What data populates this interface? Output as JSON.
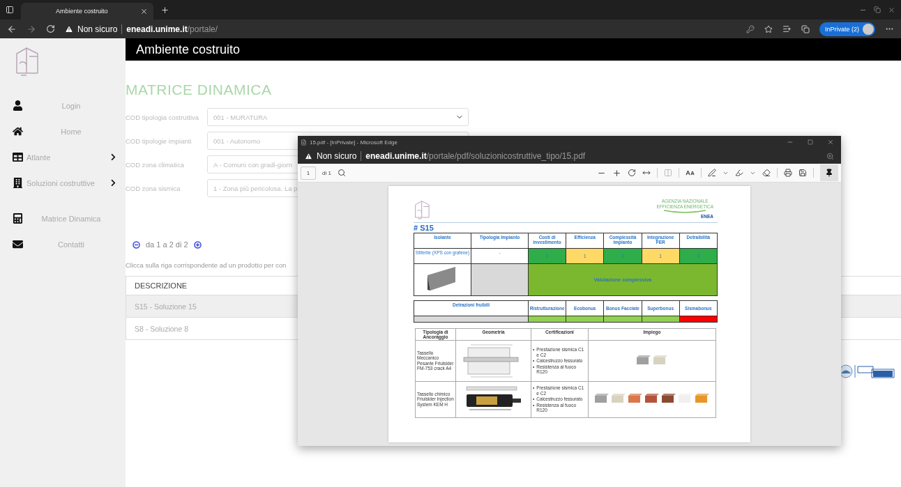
{
  "browser": {
    "tab_title": "Ambiente costruito",
    "security": "Non sicuro",
    "url_host": "eneadi.unime.it",
    "url_path": "/portale/",
    "profile": "InPrivate (2)"
  },
  "sidebar": {
    "items": [
      {
        "kind": "user",
        "label": "Login",
        "submenu": false
      },
      {
        "kind": "home",
        "label": "Home",
        "submenu": false
      },
      {
        "kind": "table",
        "label": "Atlante",
        "submenu": true
      },
      {
        "kind": "building",
        "label": "Soluzioni costruttive",
        "submenu": true
      },
      {
        "kind": "calculator",
        "label": "Matrice Dinamica",
        "submenu": false
      },
      {
        "kind": "mail",
        "label": "Contatti",
        "submenu": false
      }
    ]
  },
  "header": {
    "title": "Ambiente costruito"
  },
  "page_title": "MATRICE DINAMICA",
  "filters": [
    {
      "label": "COD tipologia costruttiva",
      "value": "001 - MURATURA"
    },
    {
      "label": "COD tipologie impianti",
      "value": "001 - Autonomo"
    },
    {
      "label": "COD zona climatica",
      "value": "A - Comuni con gradi-giorn"
    },
    {
      "label": "COD zona sismica",
      "value": "1 - Zona più pericolosa. La p"
    }
  ],
  "pager": {
    "text": "da 1 a 2 di 2"
  },
  "hint": "Clicca sulla riga corrispondente ad un prodotto per con",
  "table": {
    "columns": [
      "DESCRIZIONE"
    ],
    "rows": [
      {
        "cells": [
          "S15 - Soluzione 15"
        ],
        "selected": true
      },
      {
        "cells": [
          "S8 - Soluzione 8"
        ],
        "selected": false
      }
    ]
  },
  "pdf_window": {
    "title": "15.pdf - [InPrivate] - Microsoft Edge",
    "security": "Non sicuro",
    "url_host": "eneadi.unime.it",
    "url_path": "/portale/pdf/soluzionicostruttive_tipo/15.pdf",
    "page": "1",
    "page_count": "di 1",
    "document": {
      "agency": [
        "AGENZIA NAZIONALE",
        "EFFICIENZA ENERGETICA"
      ],
      "agency_mark": "ENEA",
      "code": "# S15",
      "matrix": {
        "columns": [
          "Isolante",
          "Tipologia Impianto",
          "Costi di investimento",
          "Efficienza",
          "Complessità impianto",
          "Integrazione FER",
          "Detraibilità"
        ],
        "isolante": "Stiferite (XPS con grafene)",
        "impianto": "-",
        "scores": [
          {
            "value": "3",
            "color": "#2fad4b"
          },
          {
            "value": "1",
            "color": "#ffd966"
          },
          {
            "value": "3",
            "color": "#2fad4b"
          },
          {
            "value": "1",
            "color": "#ffd966"
          },
          {
            "value": "3",
            "color": "#2fad4b"
          }
        ],
        "overall": "Valutazione complessiva"
      },
      "deductions": {
        "label": "Detrazioni fruibili",
        "items": [
          {
            "name": "Ristrutturazione",
            "color": "#92d050"
          },
          {
            "name": "Ecobonus",
            "color": "#92d050"
          },
          {
            "name": "Bonus Facciate",
            "color": "#92d050"
          },
          {
            "name": "Superbonus",
            "color": "#92d050"
          },
          {
            "name": "Sismabonus",
            "color": "#ff0000"
          }
        ]
      },
      "anchors": {
        "marker": "•",
        "columns": [
          "Tipologia di Ancoraggio",
          "Geometria",
          "Certificazioni",
          "Impiego"
        ],
        "rows": [
          {
            "kind": "mechanical",
            "type": "Tassello Meccanico Pesante Friulsider FM-753 crack A4",
            "certifications": [
              "Prestazione sismica C1 e C2",
              "Calcestruzzo fessurato",
              "Resistenza al fuoco R120"
            ]
          },
          {
            "kind": "chemical",
            "type": "Tassello chimico Friulsider Injection System KEM H",
            "certifications": [
              "Prestazione sismica C1 e C2",
              "Calcestruzzo fessurato",
              "Resistenza al fuoco R120"
            ]
          }
        ]
      }
    }
  }
}
